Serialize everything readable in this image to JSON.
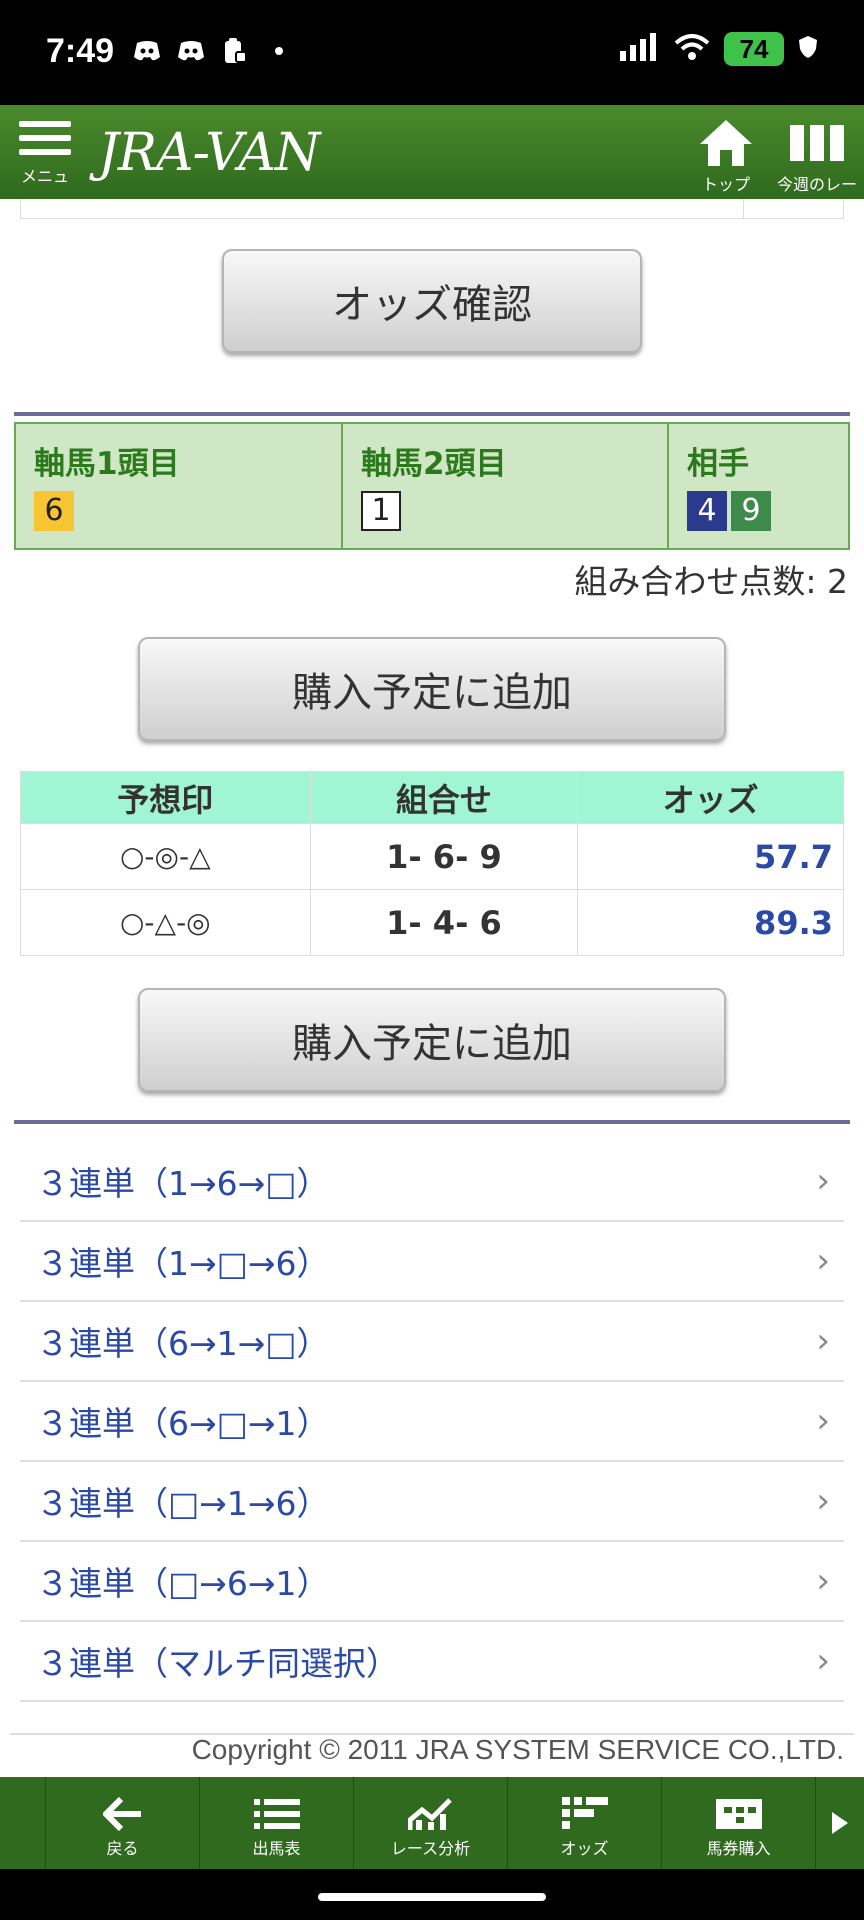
{
  "status": {
    "time": "7:49",
    "battery": "74"
  },
  "header": {
    "menu_label": "メニュー",
    "brand": "JRA-VAN",
    "top_label": "トップ",
    "week_label": "今週のレース"
  },
  "odds_button": "オッズ確認",
  "selection": {
    "col1_title": "軸馬1頭目",
    "col1_nums": [
      "6"
    ],
    "col2_title": "軸馬2頭目",
    "col2_nums": [
      "1"
    ],
    "col3_title": "相手",
    "col3_nums": [
      "4",
      "9"
    ]
  },
  "combo_count": "組み合わせ点数: 2",
  "add_button_1": "購入予定に追加",
  "results": {
    "headers": [
      "予想印",
      "組合せ",
      "オッズ"
    ],
    "rows": [
      {
        "marks": "○-◎-△",
        "combo": "1- 6- 9",
        "odds": "57.7"
      },
      {
        "marks": "○-△-◎",
        "combo": "1- 4- 6",
        "odds": "89.3"
      }
    ]
  },
  "add_button_2": "購入予定に追加",
  "links": [
    "３連単（1→6→□）",
    "３連単（1→□→6）",
    "３連単（6→1→□）",
    "３連単（6→□→1）",
    "３連単（□→1→6）",
    "３連単（□→6→1）",
    "３連単（マルチ同選択）"
  ],
  "copyright": "Copyright © 2011 JRA SYSTEM SERVICE CO.,LTD.",
  "bottom_nav": [
    "戻る",
    "出馬表",
    "レース分析",
    "オッズ",
    "馬券購入"
  ],
  "colors": {
    "header_green": "#2f6a1e",
    "link_blue": "#2b4aa6",
    "table_header": "#a0f5d4",
    "selection_bg": "#cfe7c4"
  }
}
